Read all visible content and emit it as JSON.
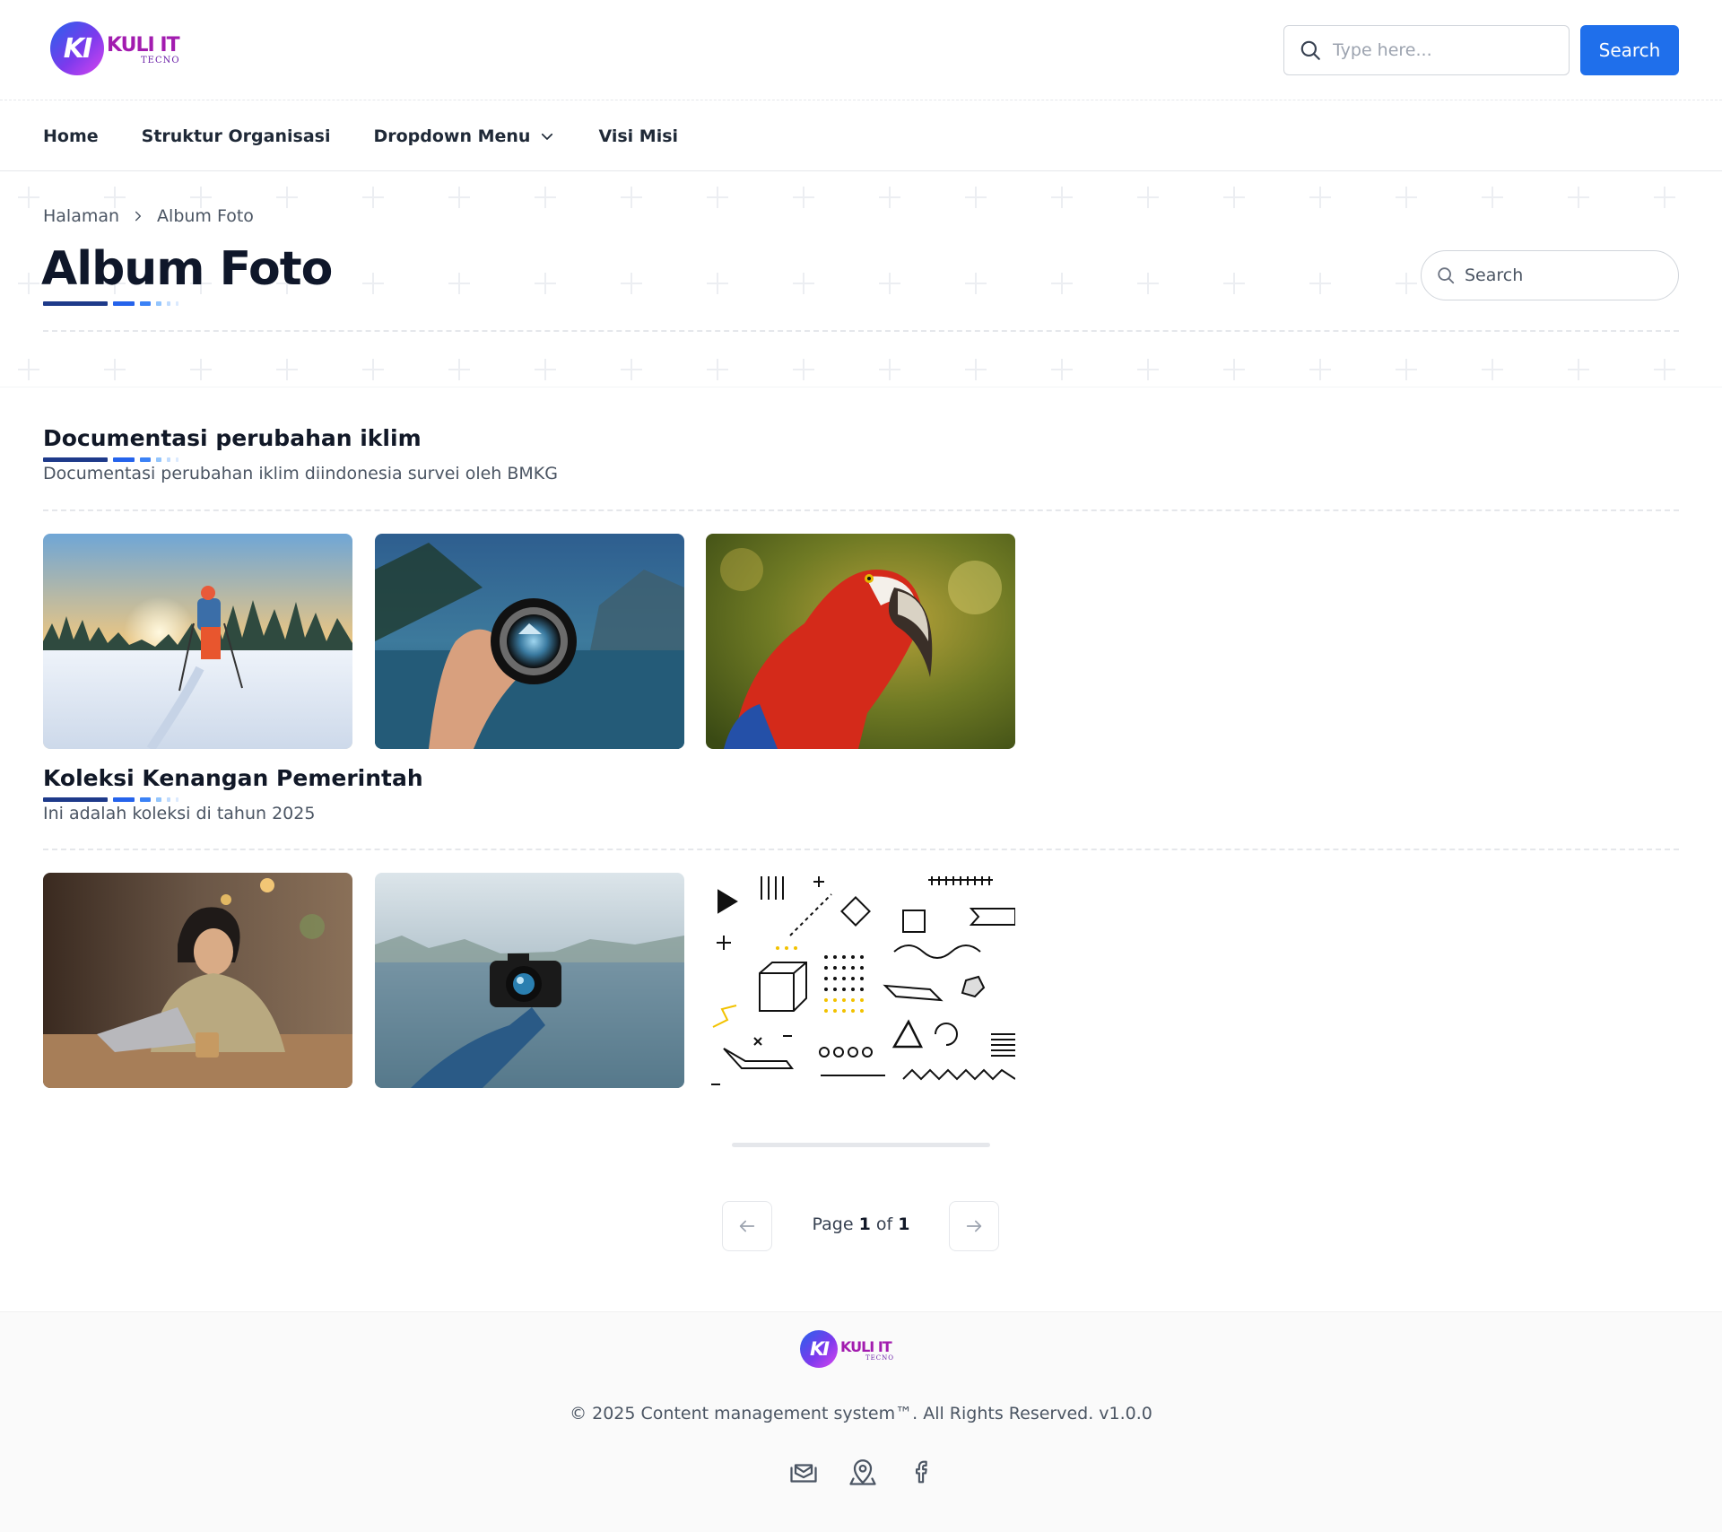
{
  "brand": {
    "logo_mark": "KI",
    "logo_word": "KULI IT",
    "logo_sub": "TECNO"
  },
  "header": {
    "search_placeholder": "Type here...",
    "search_button": "Search",
    "search_icon": "search-icon"
  },
  "nav": {
    "items": [
      {
        "label": "Home"
      },
      {
        "label": "Struktur Organisasi"
      },
      {
        "label": "Dropdown Menu",
        "icon": "chevron-down-icon"
      },
      {
        "label": "Visi Misi"
      }
    ]
  },
  "hero": {
    "breadcrumb": [
      "Halaman",
      "Album Foto"
    ],
    "title": "Album Foto",
    "search_placeholder": "Search"
  },
  "albums": [
    {
      "title": "Documentasi perubahan iklim",
      "description": "Documentasi perubahan iklim diindonesia survei oleh BMKG",
      "photos": [
        "hiker in snowy sunset",
        "hand holding camera lens over lake",
        "scarlet macaw parrot"
      ]
    },
    {
      "title": "Koleksi Kenangan Pemerintah",
      "description": "Ini adalah koleksi di tahun 2025",
      "photos": [
        "woman working on laptop in cafe",
        "hand holding camera over misty lake",
        "memphis geometric pattern"
      ]
    }
  ],
  "pagination": {
    "prefix": "Page",
    "current": "1",
    "separator": "of",
    "total": "1",
    "prev_icon": "arrow-left-icon",
    "next_icon": "arrow-right-icon"
  },
  "footer": {
    "copyright": "© 2025 Content management system™. All Rights Reserved. v1.0.0",
    "socials": [
      "mail-icon",
      "location-pin-icon",
      "facebook-icon"
    ]
  },
  "colors": {
    "accent": "#1f6feb",
    "title_dark": "#0f172a",
    "deco_dark": "#1e3a8a",
    "deco_mid": "#2563eb",
    "deco_light": "#60a5fa"
  }
}
